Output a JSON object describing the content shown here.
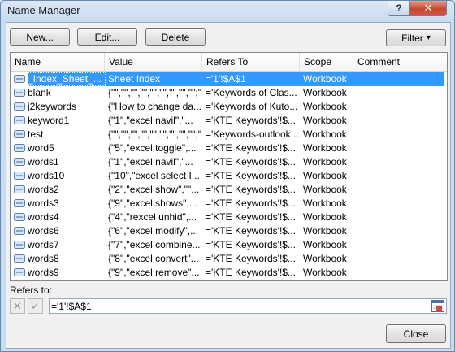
{
  "window": {
    "title": "Name Manager",
    "help_label": "?",
    "close_label": "✕"
  },
  "toolbar": {
    "new_label": "New...",
    "edit_label": "Edit...",
    "delete_label": "Delete",
    "filter_label": "Filter",
    "filter_arrow": "▾"
  },
  "columns": {
    "name": "Name",
    "value": "Value",
    "refers_to": "Refers To",
    "scope": "Scope",
    "comment": "Comment"
  },
  "rows": [
    {
      "name": "_Index_Sheet_...",
      "value": "Sheet Index",
      "refers_to": "='1'!$A$1",
      "scope": "Workbook",
      "comment": ""
    },
    {
      "name": "blank",
      "value": "{\"\",\"\",\"\",\"\",\"\",\"\",\"\",\"\",\"\";\"\"...",
      "refers_to": "='Keywords of Clas...",
      "scope": "Workbook",
      "comment": ""
    },
    {
      "name": "j2keywords",
      "value": "{\"How to change da...",
      "refers_to": "='Keywords of Kuto...",
      "scope": "Workbook",
      "comment": ""
    },
    {
      "name": "keyword1",
      "value": "{\"1\",\"excel navil\",\"...",
      "refers_to": "='KTE Keywords'!$...",
      "scope": "Workbook",
      "comment": ""
    },
    {
      "name": "test",
      "value": "{\"\",\"\",\"\",\"\",\"\",\"\",\"\",\"\",\"\";\"\"...",
      "refers_to": "='Keywords-outlook...",
      "scope": "Workbook",
      "comment": ""
    },
    {
      "name": "word5",
      "value": "{\"5\",\"excel toggle\",...",
      "refers_to": "='KTE Keywords'!$...",
      "scope": "Workbook",
      "comment": ""
    },
    {
      "name": "words1",
      "value": "{\"1\",\"excel navil\",\"...",
      "refers_to": "='KTE Keywords'!$...",
      "scope": "Workbook",
      "comment": ""
    },
    {
      "name": "words10",
      "value": "{\"10\",\"excel select I...",
      "refers_to": "='KTE Keywords'!$...",
      "scope": "Workbook",
      "comment": ""
    },
    {
      "name": "words2",
      "value": "{\"2\",\"excel show\",\"\"...",
      "refers_to": "='KTE Keywords'!$...",
      "scope": "Workbook",
      "comment": ""
    },
    {
      "name": "words3",
      "value": "{\"9\",\"excel shows\",...",
      "refers_to": "='KTE Keywords'!$...",
      "scope": "Workbook",
      "comment": ""
    },
    {
      "name": "words4",
      "value": "{\"4\",\"rexcel unhid\",...",
      "refers_to": "='KTE Keywords'!$...",
      "scope": "Workbook",
      "comment": ""
    },
    {
      "name": "words6",
      "value": "{\"6\",\"excel modify\",...",
      "refers_to": "='KTE Keywords'!$...",
      "scope": "Workbook",
      "comment": ""
    },
    {
      "name": "words7",
      "value": "{\"7\",\"excel combine...",
      "refers_to": "='KTE Keywords'!$...",
      "scope": "Workbook",
      "comment": ""
    },
    {
      "name": "words8",
      "value": "{\"8\",\"excel convert\"...",
      "refers_to": "='KTE Keywords'!$...",
      "scope": "Workbook",
      "comment": ""
    },
    {
      "name": "words9",
      "value": "{\"9\",\"excel remove\"...",
      "refers_to": "='KTE Keywords'!$...",
      "scope": "Workbook",
      "comment": ""
    }
  ],
  "selected_row": 0,
  "refers": {
    "label": "Refers to:",
    "value": "='1'!$A$1",
    "cancel_glyph": "✕",
    "confirm_glyph": "✓"
  },
  "footer": {
    "close_label": "Close"
  },
  "colors": {
    "selection": "#3399ff",
    "accent": "#4a90d9"
  }
}
